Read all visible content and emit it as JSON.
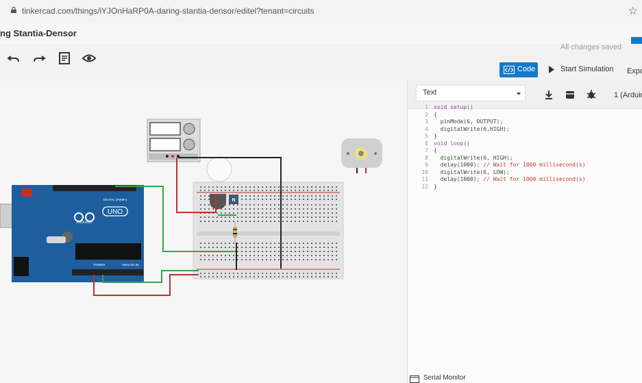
{
  "browser": {
    "url": "tinkercad.com/things/iYJOnHaRP0A-daring-stantia-densor/editel?tenant=circuits"
  },
  "header": {
    "title": "ng Stantia-Densor"
  },
  "toolbar": {
    "status": "All changes saved",
    "code_label": "Code",
    "simulation_label": "Start Simulation",
    "export_label": "Expo"
  },
  "circuit": {
    "board_text": {
      "uno": "UNO",
      "arduino": "ARDUINO",
      "digital": "DIGITAL (PWM~)",
      "power": "POWER",
      "analog": "ANALOG IN",
      "transistor": "N"
    }
  },
  "code_panel": {
    "mode": "Text",
    "device": "1 (Arduin",
    "lines": [
      {
        "n": "1",
        "text": "void setup()"
      },
      {
        "n": "2",
        "text": "{"
      },
      {
        "n": "3",
        "text": "  pinMode(6, OUTPUT);"
      },
      {
        "n": "4",
        "text": "  digitalWrite(6,HIGH);"
      },
      {
        "n": "5",
        "text": "}"
      },
      {
        "n": "6",
        "text": "void loop()"
      },
      {
        "n": "7",
        "text": "{"
      },
      {
        "n": "8",
        "text": "  digitalWrite(6, HIGH);"
      },
      {
        "n": "9",
        "text": "  delay(1000); ",
        "comment": "// Wait for 1000 millisecond(s)"
      },
      {
        "n": "10",
        "text": "  digitalWrite(6, LOW);"
      },
      {
        "n": "11",
        "text": "  delay(1000); ",
        "comment": "// Wait for 1000 millisecond(s)"
      },
      {
        "n": "12",
        "text": "}"
      }
    ]
  },
  "footer": {
    "serial_monitor": "Serial Monitor"
  },
  "colors": {
    "accent": "#1479c8",
    "board": "#1f5e9e",
    "wire_green": "#3aa04a",
    "wire_red": "#c0302a",
    "wire_black": "#222222"
  }
}
